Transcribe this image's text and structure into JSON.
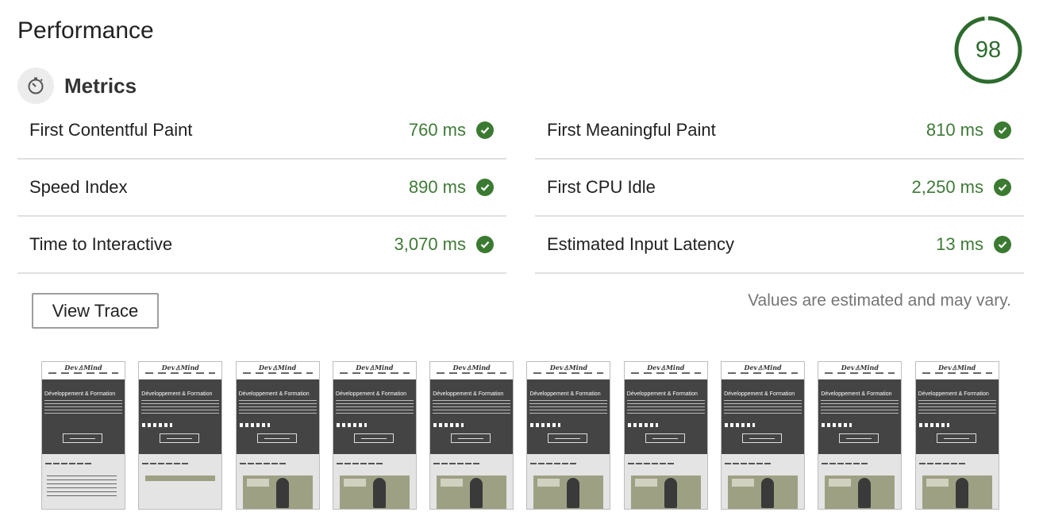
{
  "header": {
    "title": "Performance",
    "score": "98",
    "score_fraction": 0.98
  },
  "metrics": {
    "title": "Metrics",
    "left": [
      {
        "label": "First Contentful Paint",
        "value": "760 ms",
        "status": "pass"
      },
      {
        "label": "Speed Index",
        "value": "890 ms",
        "status": "pass"
      },
      {
        "label": "Time to Interactive",
        "value": "3,070 ms",
        "status": "pass"
      }
    ],
    "right": [
      {
        "label": "First Meaningful Paint",
        "value": "810 ms",
        "status": "pass"
      },
      {
        "label": "First CPU Idle",
        "value": "2,250 ms",
        "status": "pass"
      },
      {
        "label": "Estimated Input Latency",
        "value": "13 ms",
        "status": "pass"
      }
    ]
  },
  "actions": {
    "view_trace": "View Trace"
  },
  "note": "Values are estimated and may vary.",
  "filmstrip": {
    "logo": "Dev♙Mind",
    "hero_title": "Développement & Formation",
    "frames": [
      "partial-text",
      "partial-image",
      "full",
      "full",
      "full",
      "full",
      "full",
      "full",
      "full",
      "full"
    ]
  },
  "colors": {
    "pass": "#3b7a31",
    "score": "#2e6b2e",
    "gauge_track": "#e0e0e0"
  }
}
